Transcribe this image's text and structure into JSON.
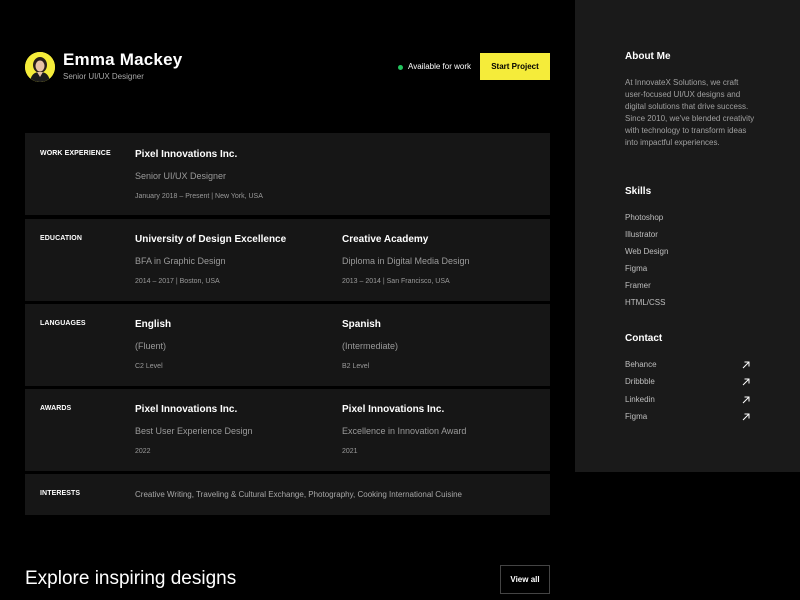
{
  "profile": {
    "name": "Emma Mackey",
    "role": "Senior UI/UX Designer",
    "status": "Available for work",
    "cta_label": "Start Project"
  },
  "sections": {
    "work": {
      "label": "WORK EXPERIENCE",
      "items": [
        {
          "title": "Pixel Innovations Inc.",
          "subtitle": "Senior UI/UX Designer",
          "meta": "January 2018 – Present | New York, USA"
        }
      ]
    },
    "education": {
      "label": "EDUCATION",
      "items": [
        {
          "title": "University of Design Excellence",
          "subtitle": "BFA in Graphic Design",
          "meta": "2014 – 2017 | Boston, USA"
        },
        {
          "title": "Creative Academy",
          "subtitle": "Diploma in Digital Media Design",
          "meta": "2013 – 2014 | San Francisco, USA"
        }
      ]
    },
    "languages": {
      "label": "LANGUAGES",
      "items": [
        {
          "title": "English",
          "subtitle": "(Fluent)",
          "meta": "C2 Level"
        },
        {
          "title": "Spanish",
          "subtitle": "(Intermediate)",
          "meta": "B2 Level"
        }
      ]
    },
    "awards": {
      "label": "AWARDS",
      "items": [
        {
          "title": "Pixel Innovations Inc.",
          "subtitle": "Best User Experience Design",
          "meta": "2022"
        },
        {
          "title": "Pixel Innovations Inc.",
          "subtitle": "Excellence in Innovation Award",
          "meta": "2021"
        }
      ]
    },
    "interests": {
      "label": "INTERESTS",
      "text": "Creative Writing, Traveling & Cultural Exchange, Photography, Cooking International Cuisine"
    }
  },
  "sidebar": {
    "about": {
      "title": "About Me",
      "text": "At InnovateX Solutions, we craft user-focused UI/UX designs and digital solutions that drive success. Since 2010, we've blended creativity with technology to transform ideas into impactful experiences."
    },
    "skills": {
      "title": "Skills",
      "items": [
        "Photoshop",
        "Illustrator",
        "Web Design",
        "Figma",
        "Framer",
        "HTML/CSS"
      ]
    },
    "contact": {
      "title": "Contact",
      "items": [
        {
          "label": "Behance",
          "icon": "arrow-up-right-icon"
        },
        {
          "label": "Dribbble",
          "icon": "arrow-up-right-icon"
        },
        {
          "label": "Linkedin",
          "icon": "arrow-up-right-icon"
        },
        {
          "label": "Figma",
          "icon": "arrow-up-right-icon"
        }
      ]
    }
  },
  "explore": {
    "title": "Explore inspiring designs",
    "button_label": "View all"
  },
  "colors": {
    "accent": "#f5ec3a",
    "status": "#22c55e",
    "background": "#000000",
    "card": "#161616",
    "sidebar": "#1a1a1a"
  }
}
